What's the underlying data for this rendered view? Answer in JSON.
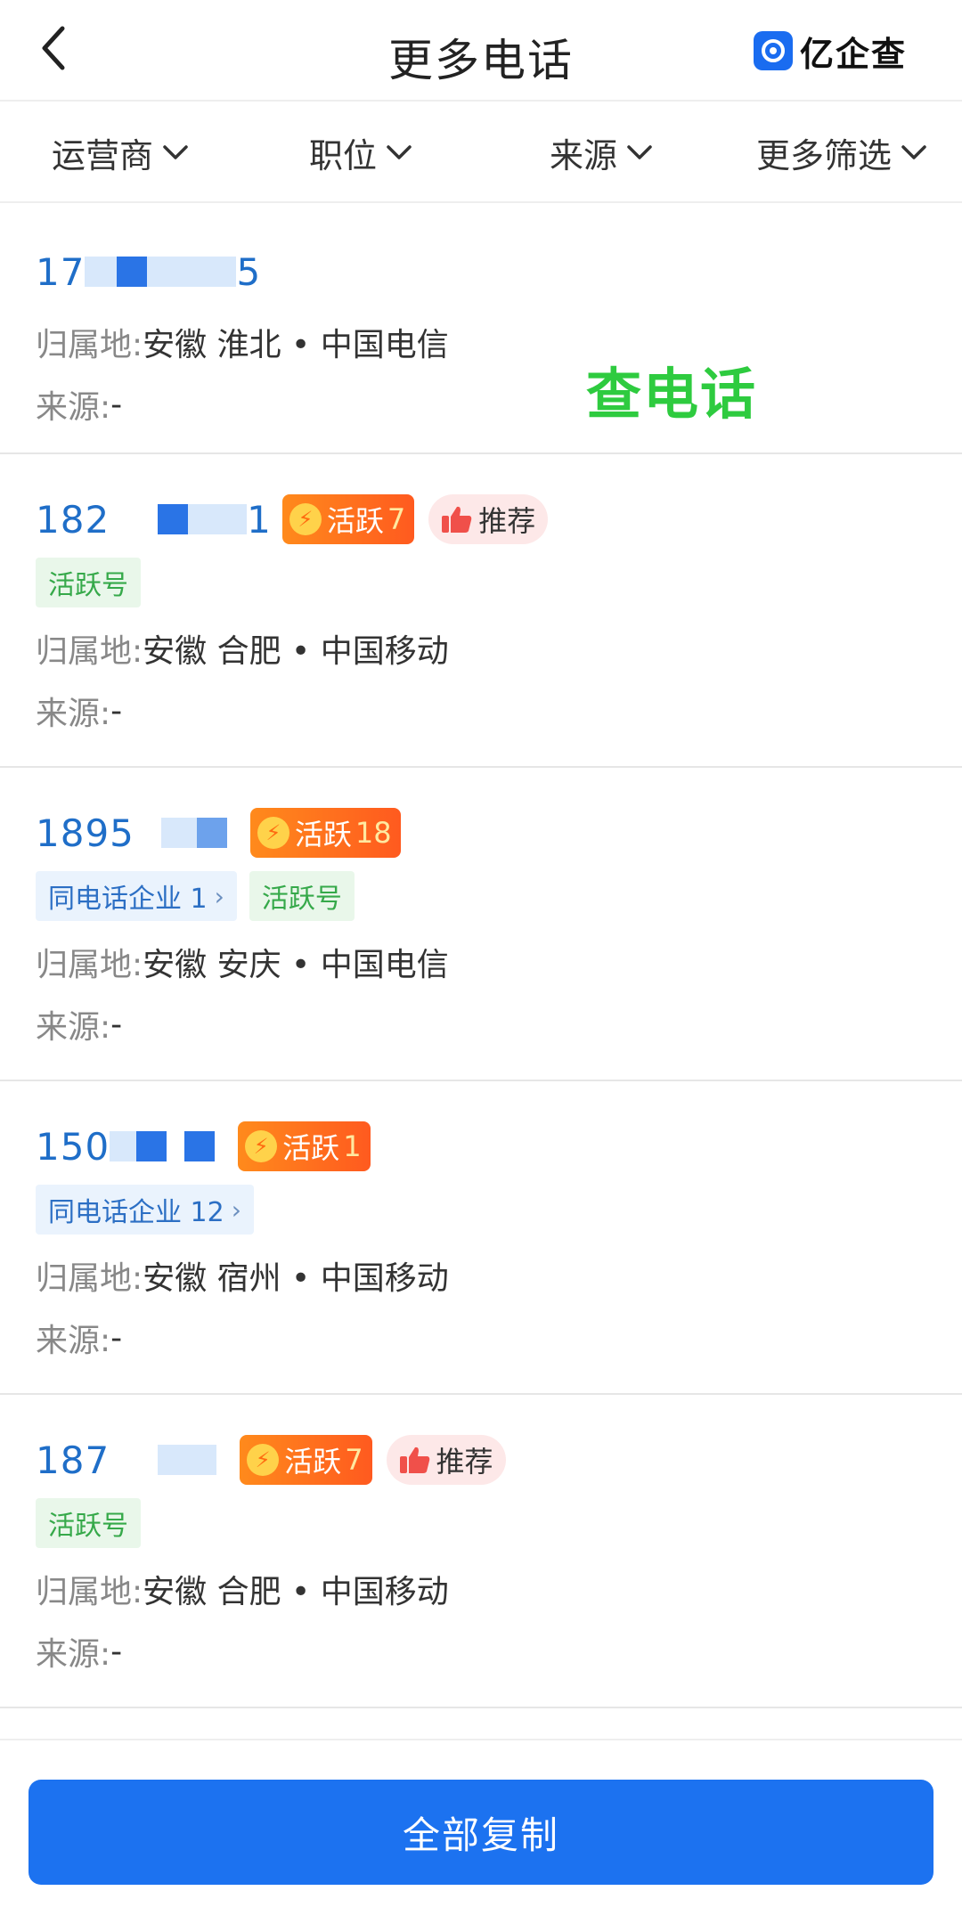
{
  "header": {
    "title": "更多电话",
    "brand": "亿企查"
  },
  "filters": [
    {
      "label": "运营商"
    },
    {
      "label": "职位"
    },
    {
      "label": "来源"
    },
    {
      "label": "更多筛选"
    }
  ],
  "watermark": "查电话",
  "labels": {
    "location": "归属地:",
    "source": "来源:"
  },
  "items": [
    {
      "phone_prefix": "17",
      "phone_suffix": "5",
      "location": "安徽 淮北 • 中国电信",
      "source": "-"
    },
    {
      "phone_prefix": "182",
      "phone_suffix": "1",
      "active_label": "活跃",
      "active_count": "7",
      "recommend": "推荐",
      "tags": [
        "活跃号"
      ],
      "location": "安徽 合肥 • 中国移动",
      "source": "-"
    },
    {
      "phone_prefix": "1895",
      "active_label": "活跃",
      "active_count": "18",
      "related": "同电话企业 1",
      "tags": [
        "活跃号"
      ],
      "location": "安徽 安庆 • 中国电信",
      "source": "-"
    },
    {
      "phone_prefix": "150",
      "active_label": "活跃",
      "active_count": "1",
      "related": "同电话企业 12",
      "location": "安徽 宿州 • 中国移动",
      "source": "-"
    },
    {
      "phone_prefix": "187",
      "active_label": "活跃",
      "active_count": "7",
      "recommend": "推荐",
      "tags": [
        "活跃号"
      ],
      "location": "安徽 合肥 • 中国移动",
      "source": "-"
    }
  ],
  "bottom": {
    "copy_all": "全部复制"
  },
  "colors": {
    "accent": "#1c72f0",
    "phone": "#1f6ec8",
    "active_badge": "#ff6a1f",
    "green_tag": "#36a94a",
    "watermark": "#2ecb3f"
  }
}
